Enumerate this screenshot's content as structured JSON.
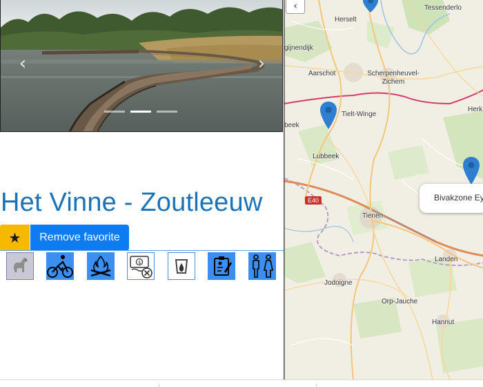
{
  "place": {
    "title": "Het Vinne - Zoutleeuw",
    "remove_favorite_label": "Remove favorite"
  },
  "carousel": {
    "prev_icon": "chevron-left-icon",
    "next_icon": "chevron-right-icon",
    "slide_count": 3,
    "active_slide": 2
  },
  "amenities": [
    {
      "name": "dog-icon",
      "active": false
    },
    {
      "name": "cycling-icon",
      "active": true
    },
    {
      "name": "campfire-icon",
      "active": true
    },
    {
      "name": "no-payment-icon",
      "active": false
    },
    {
      "name": "water-icon",
      "active": false
    },
    {
      "name": "registration-icon",
      "active": true
    },
    {
      "name": "toilet-icon",
      "active": true
    }
  ],
  "map": {
    "collapse_icon": "chevron-left-icon",
    "road_badge": "E40",
    "popup_text": "Bivakzone Ey",
    "towns": [
      "Tessenderlo",
      "Herselt",
      "gijnendijk",
      "Aarschot",
      "Scherpenheuvel-Zichem",
      "Herk",
      "Tielt-Winge",
      "beek",
      "Lubbeek",
      "Tienen",
      "Landen",
      "Jodoigne",
      "Orp-Jauche",
      "Hannut"
    ]
  },
  "colors": {
    "title": "#1a73b8",
    "star_button": "#f6b900",
    "primary_button": "#0d7bf2",
    "amenity_active": "#3b8ff0",
    "marker": "#2f7fd1"
  }
}
